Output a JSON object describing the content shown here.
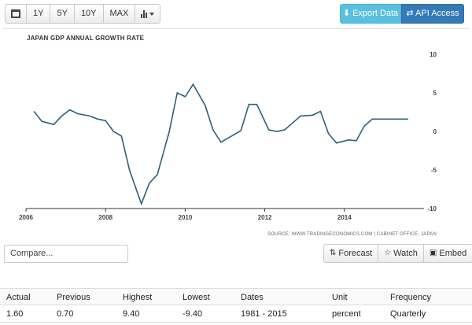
{
  "toolbar": {
    "ranges": [
      "1Y",
      "5Y",
      "10Y",
      "MAX"
    ],
    "calendar_icon": "calendar-icon",
    "chart_type_icon": "bar-chart-icon",
    "export_label": "Export Data",
    "api_label": "API Access",
    "export_color": "#5bc0de",
    "api_color": "#337ab7"
  },
  "chart_data": {
    "type": "line",
    "title": "JAPAN GDP ANNUAL GROWTH RATE",
    "source": "SOURCE: WWW.TRADINGECONOMICS.COM | CABINET OFFICE, JAPAN",
    "x_ticks": [
      "2006",
      "2008",
      "2010",
      "2012",
      "2014"
    ],
    "y_ticks": [
      "10",
      "5",
      "0",
      "-5",
      "-10"
    ],
    "xlim": [
      2006.0,
      2016.0
    ],
    "ylim": [
      -10,
      10
    ],
    "line_color": "#2f5f7a",
    "grid": false,
    "series": [
      {
        "x": [
          2006.2,
          2006.4,
          2006.7,
          2006.9,
          2007.1,
          2007.3,
          2007.6,
          2007.8,
          2008.0,
          2008.2,
          2008.4,
          2008.6,
          2008.9,
          2009.1,
          2009.3,
          2009.6,
          2009.8,
          2010.0,
          2010.2,
          2010.5,
          2010.7,
          2010.9,
          2011.2,
          2011.4,
          2011.6,
          2011.8,
          2012.1,
          2012.3,
          2012.5,
          2012.7,
          2012.9,
          2013.2,
          2013.4,
          2013.6,
          2013.8,
          2014.1,
          2014.3,
          2014.5,
          2014.7,
          2014.9,
          2015.2,
          2015.4,
          2015.6
        ],
        "values": [
          2.6,
          1.3,
          0.9,
          2.0,
          2.8,
          2.3,
          2.0,
          1.6,
          1.4,
          0.0,
          -0.6,
          -5.0,
          -9.4,
          -6.7,
          -5.6,
          0.0,
          5.0,
          4.5,
          6.1,
          3.4,
          0.2,
          -1.4,
          -0.5,
          0.1,
          3.5,
          3.5,
          0.2,
          0.0,
          0.2,
          1.1,
          2.0,
          2.1,
          2.6,
          -0.3,
          -1.5,
          -1.1,
          -1.2,
          0.7,
          1.6,
          1.6,
          1.6,
          1.6,
          1.6
        ]
      }
    ]
  },
  "compare": {
    "placeholder": "Compare..."
  },
  "actions": {
    "forecast": "Forecast",
    "watch": "Watch",
    "embed": "Embed"
  },
  "stats": {
    "headers": [
      "Actual",
      "Previous",
      "Highest",
      "Lowest",
      "Dates",
      "Unit",
      "Frequency"
    ],
    "values": [
      "1.60",
      "0.70",
      "9.40",
      "-9.40",
      "1981 - 2015",
      "percent",
      "Quarterly"
    ]
  }
}
